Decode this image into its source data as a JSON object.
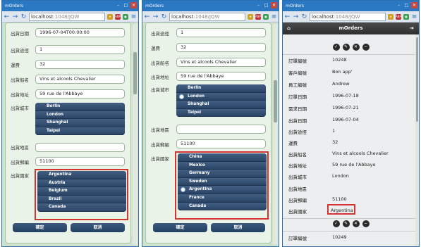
{
  "browser": {
    "tab_title": "mOrders",
    "url_host": "localhost",
    "url_rest": ":1048/JQW"
  },
  "edit_form_left": {
    "fields": [
      {
        "label": "出貨日期",
        "value": "1996-07-04T00:00:00"
      },
      {
        "label": "出貨途徑",
        "value": "1"
      },
      {
        "label": "運費",
        "value": "32"
      },
      {
        "label": "出貨船名",
        "value": "Vins et alcools Chevalier"
      },
      {
        "label": "出貨地址",
        "value": "59 rue de l'Abbaye"
      }
    ],
    "city_label": "出貨城市",
    "cities": [
      "Berlin",
      "London",
      "Shanghai",
      "Taipei"
    ],
    "region_label": "出貨地區",
    "region_value": "",
    "postal_label": "出貨郵編",
    "postal_value": "51100",
    "country_label": "出貨國家",
    "countries": [
      "Argentina",
      "Austria",
      "Belgium",
      "Brazil",
      "Canada"
    ],
    "confirm_label": "確定",
    "cancel_label": "取消"
  },
  "edit_form_middle": {
    "fields": [
      {
        "label": "出貨途徑",
        "value": "1"
      },
      {
        "label": "運費",
        "value": "32"
      },
      {
        "label": "出貨船名",
        "value": "Vins et alcools Chevalier"
      },
      {
        "label": "出貨地址",
        "value": "59 rue de l'Abbaye"
      }
    ],
    "city_label": "出貨城市",
    "cities": [
      "Berlin",
      "London",
      "Shanghai",
      "Taipei"
    ],
    "selected_city": "London",
    "region_label": "出貨地區",
    "region_value": "",
    "postal_label": "出貨郵編",
    "postal_value": "51100",
    "country_label": "出貨國家",
    "countries": [
      "China",
      "Mexico",
      "Germany",
      "Sweden",
      "Argentina",
      "France",
      "Canada"
    ],
    "selected_country": "Argentina",
    "confirm_label": "確定",
    "cancel_label": "取消"
  },
  "detail_view": {
    "header_title": "mOrders",
    "record1": [
      {
        "label": "訂單編號",
        "value": "10248"
      },
      {
        "label": "客戶編號",
        "value": "Bon app'"
      },
      {
        "label": "員工編號",
        "value": "Andrew"
      },
      {
        "label": "訂單日期",
        "value": "1996-07-18"
      },
      {
        "label": "需求日期",
        "value": "1996-07-21"
      },
      {
        "label": "出貨日期",
        "value": "1996-07-04"
      },
      {
        "label": "出貨途徑",
        "value": "1"
      },
      {
        "label": "運費",
        "value": "32"
      },
      {
        "label": "出貨船名",
        "value": "Vins et alcools Chevalier"
      },
      {
        "label": "出貨地址",
        "value": "59 rue de l'Abbaye"
      },
      {
        "label": "出貨城市",
        "value": "London"
      },
      {
        "label": "出貨地區",
        "value": ""
      },
      {
        "label": "出貨郵編",
        "value": "51100"
      },
      {
        "label": "出貨國家",
        "value": "Argentina"
      }
    ],
    "record2": [
      {
        "label": "訂單編號",
        "value": "10249"
      }
    ]
  },
  "colors": {
    "highlight": "#d5332f",
    "list_bg": "#2c4766",
    "panel_bg": "#eaf3e8"
  }
}
